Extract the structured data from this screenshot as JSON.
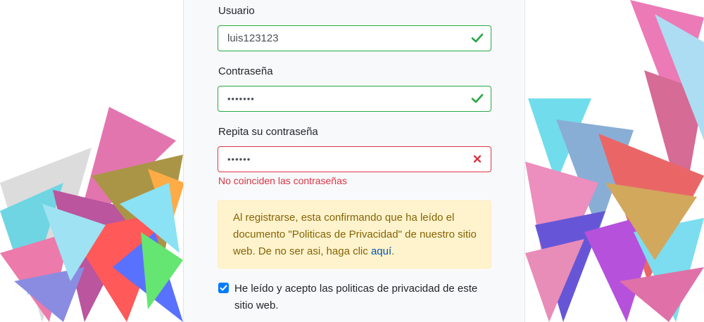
{
  "form": {
    "username": {
      "label": "Usuario",
      "value": "luis123123",
      "state": "valid"
    },
    "password": {
      "label": "Contraseña",
      "value": "•••••••",
      "state": "valid"
    },
    "confirm_password": {
      "label": "Repita su contraseña",
      "value": "••••••",
      "state": "invalid",
      "error": "No coinciden las contraseñas"
    },
    "notice": {
      "text_before": "Al registrarse, esta confirmando que ha leído el documento \"Politicas de Privacidad\" de nuestro sitio web. De no ser asi, haga clic ",
      "link": "aquí",
      "text_after": "."
    },
    "accept": {
      "label": "He leído y acepto las politicas de privacidad de este sitio web.",
      "checked": true
    }
  },
  "icons": {
    "valid": "check-icon",
    "invalid": "x-icon"
  },
  "colors": {
    "valid": "#28a745",
    "invalid": "#dc3545",
    "alert_bg": "#fff3cd",
    "alert_text": "#856404",
    "link": "#0056b3",
    "checkbox": "#007bff"
  }
}
